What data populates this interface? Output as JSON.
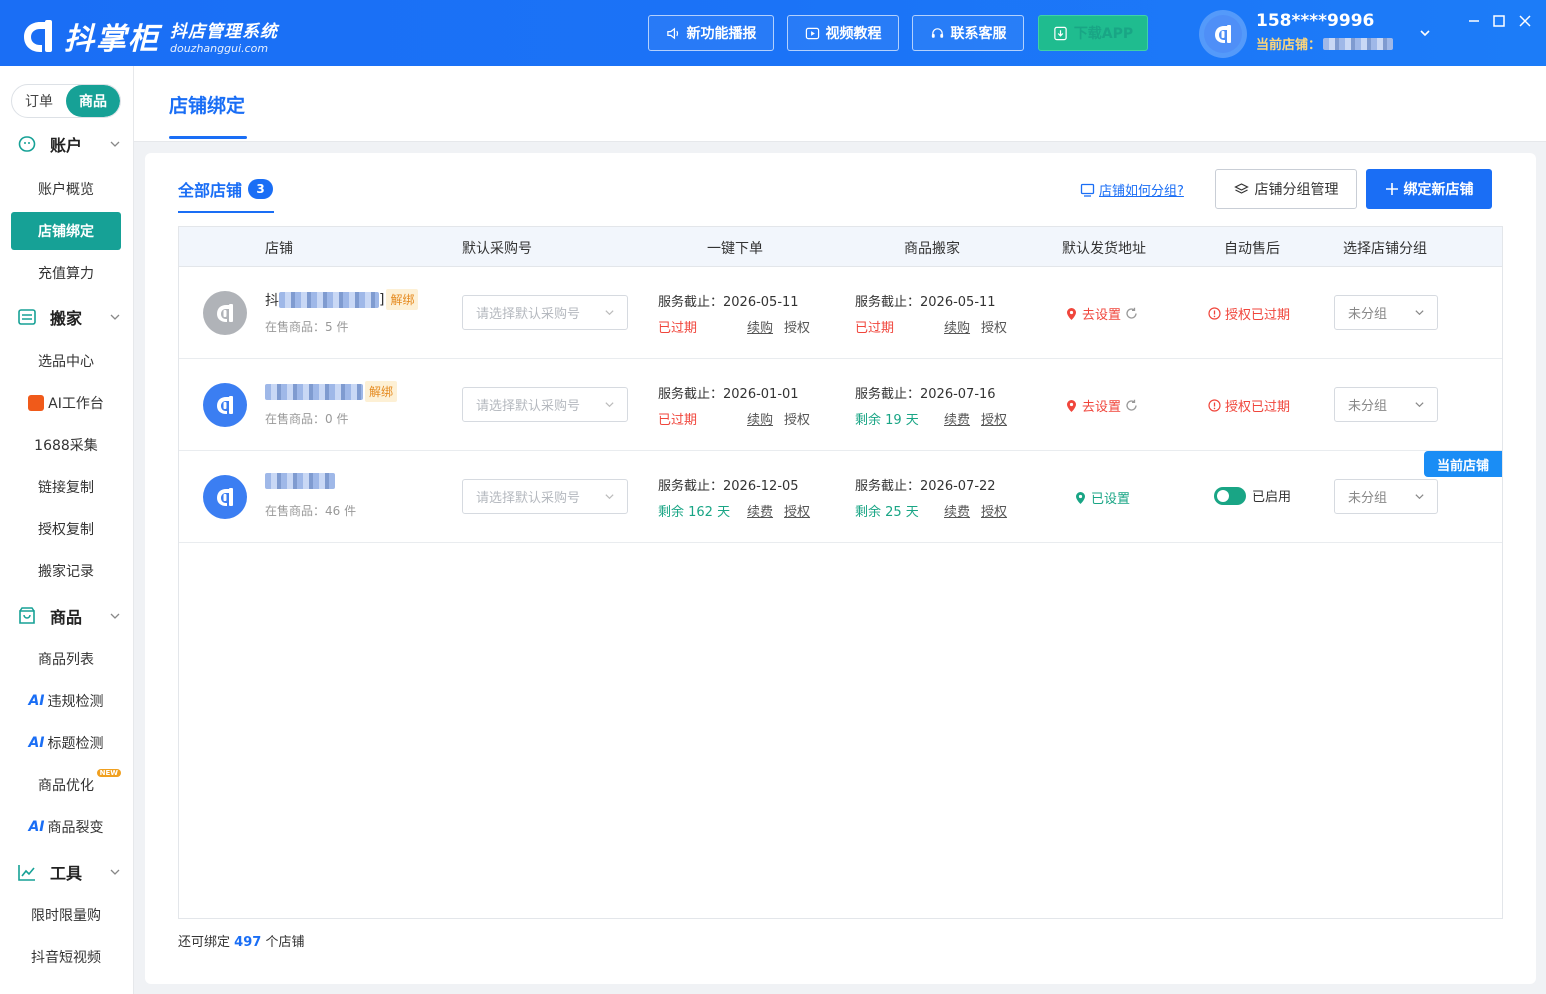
{
  "app": {
    "brand_name": "抖掌柜",
    "brand_sub": "抖店管理系统",
    "brand_url": "douzhanggui.com"
  },
  "topbar": {
    "buttons": [
      {
        "label": "新功能播报",
        "icon": "speaker-icon"
      },
      {
        "label": "视频教程",
        "icon": "video-icon"
      },
      {
        "label": "联系客服",
        "icon": "headset-icon"
      },
      {
        "label": "下载APP",
        "icon": "download-icon"
      }
    ],
    "user_phone": "158****9996",
    "current_store_label": "当前店铺："
  },
  "sidebar": {
    "segments": [
      "订单",
      "商品"
    ],
    "active_segment": "商品",
    "groups": [
      {
        "label": "账户",
        "icon": "account-icon"
      },
      {
        "label": "搬家",
        "icon": "move-icon"
      },
      {
        "label": "商品",
        "icon": "goods-icon"
      },
      {
        "label": "工具",
        "icon": "tools-icon"
      }
    ],
    "items": {
      "account_overview": "账户概览",
      "store_binding": "店铺绑定",
      "recharge": "充值算力",
      "select_center": "选品中心",
      "ai_workbench": "AI工作台",
      "collect_1688": "1688采集",
      "link_copy": "链接复制",
      "auth_copy": "授权复制",
      "move_records": "搬家记录",
      "goods_list": "商品列表",
      "violation_check": "违规检测",
      "title_check": "标题检测",
      "goods_optimize": "商品优化",
      "goods_fission": "商品裂变",
      "flash_sale": "限时限量购",
      "douyin_video": "抖音短视频"
    },
    "ai_prefix": "AI",
    "new_badge": "NEW"
  },
  "page": {
    "title": "店铺绑定",
    "tab_all": "全部店铺",
    "tab_count": "3",
    "help_link": "店铺如何分组?",
    "group_manage_btn": "店铺分组管理",
    "bind_new_btn": "绑定新店铺"
  },
  "table": {
    "headers": [
      "店铺",
      "默认采购号",
      "一键下单",
      "商品搬家",
      "默认发货地址",
      "自动售后",
      "选择店铺分组"
    ],
    "purchase_placeholder": "请选择默认采购号",
    "group_value": "未分组",
    "unbind_label": "解绑",
    "current_store_tag": "当前店铺",
    "rows": [
      {
        "name_prefix": "抖",
        "name_suffix": "]",
        "on_sale": "在售商品：5 件",
        "show_unbind": true,
        "order_deadline": "服务截止：2026-05-11",
        "order_status": "已过期",
        "order_status_type": "red",
        "order_link1": "续购",
        "order_link2": "授权",
        "move_deadline": "服务截止：2026-05-11",
        "move_status": "已过期",
        "move_status_type": "red",
        "move_link1": "续购",
        "move_link2": "授权",
        "address": "去设置",
        "address_type": "red",
        "after_sale": "授权已过期",
        "after_sale_type": "expired"
      },
      {
        "name_prefix": "",
        "name_suffix": "",
        "on_sale": "在售商品：0 件",
        "show_unbind": true,
        "order_deadline": "服务截止：2026-01-01",
        "order_status": "已过期",
        "order_status_type": "red",
        "order_link1": "续购",
        "order_link2": "授权",
        "move_deadline": "服务截止：2026-07-16",
        "move_status": "剩余 19 天",
        "move_status_type": "green",
        "move_link1": "续费",
        "move_link2": "授权",
        "address": "去设置",
        "address_type": "red",
        "after_sale": "授权已过期",
        "after_sale_type": "expired"
      },
      {
        "name_prefix": "",
        "name_suffix": "",
        "on_sale": "在售商品：46 件",
        "show_unbind": false,
        "order_deadline": "服务截止：2026-12-05",
        "order_status": "剩余 162 天",
        "order_status_type": "green",
        "order_link1": "续费",
        "order_link2": "授权",
        "move_deadline": "服务截止：2026-07-22",
        "move_status": "剩余 25 天",
        "move_status_type": "green",
        "move_link1": "续费",
        "move_link2": "授权",
        "address": "已设置",
        "address_type": "green",
        "after_sale": "已启用",
        "after_sale_type": "enabled"
      }
    ]
  },
  "footer": {
    "prefix": "还可绑定",
    "count": "497",
    "suffix": "个店铺"
  },
  "colors": {
    "primary": "#1a6ef5",
    "teal": "#16a196",
    "danger": "#f0463c",
    "success": "#19a585"
  }
}
